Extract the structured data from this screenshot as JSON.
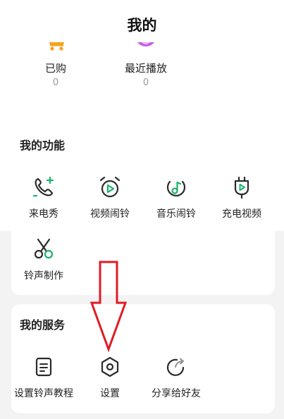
{
  "header": {
    "title": "我的"
  },
  "stats": [
    {
      "label": "已购",
      "count": "0",
      "icon": "cart-icon"
    },
    {
      "label": "最近播放",
      "count": "0",
      "icon": "recent-play-icon"
    }
  ],
  "functions": {
    "title": "我的功能",
    "items": [
      {
        "label": "来电秀",
        "icon": "phone-call-icon"
      },
      {
        "label": "视频闹铃",
        "icon": "alarm-video-icon"
      },
      {
        "label": "音乐闹铃",
        "icon": "alarm-music-icon"
      },
      {
        "label": "充电视频",
        "icon": "charging-video-icon"
      },
      {
        "label": "铃声制作",
        "icon": "scissors-icon"
      }
    ]
  },
  "services": {
    "title": "我的服务",
    "items": [
      {
        "label": "设置铃声教程",
        "icon": "tutorial-icon"
      },
      {
        "label": "设置",
        "icon": "settings-icon"
      },
      {
        "label": "分享给好友",
        "icon": "share-icon"
      }
    ]
  },
  "colors": {
    "accent": "#19b26b",
    "annotation": "#e01b24",
    "icon_dark": "#2b2b2b"
  }
}
